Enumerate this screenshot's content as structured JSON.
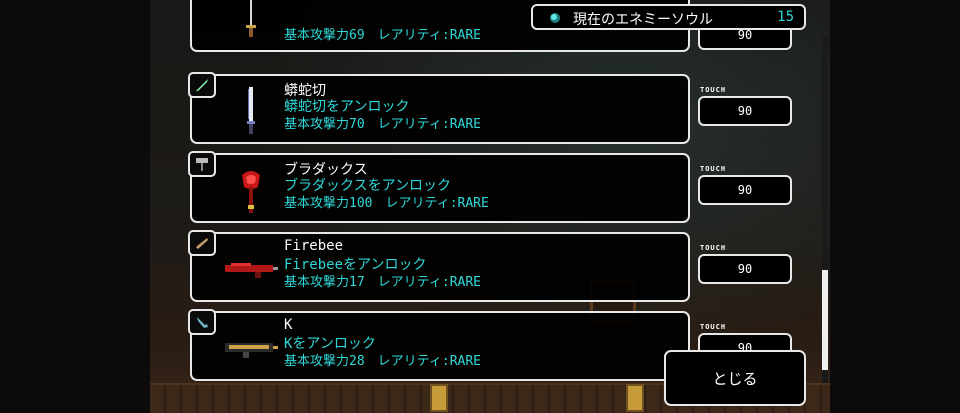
{
  "header": {
    "soul_label": "現在のエネミーソウル",
    "soul_value": "15",
    "soul_icon": "soul-orb-icon"
  },
  "touch_label": "TOUCH",
  "items": [
    {
      "name": "",
      "unlock": "",
      "stats": "基本攻撃力69　レアリティ:RARE",
      "cost": "90",
      "icon": "sword-icon",
      "color": "#c9a24a"
    },
    {
      "name": "蟒蛇切",
      "unlock": "蟒蛇切をアンロック",
      "stats": "基本攻撃力70　レアリティ:RARE",
      "cost": "90",
      "icon": "sword-icon",
      "color": "#d8d8e8"
    },
    {
      "name": "ブラダックス",
      "unlock": "ブラダックスをアンロック",
      "stats": "基本攻撃力100　レアリティ:RARE",
      "cost": "90",
      "icon": "hammer-icon",
      "color": "#d02020"
    },
    {
      "name": "Firebee",
      "unlock": "Firebeeをアンロック",
      "stats": "基本攻撃力17　レアリティ:RARE",
      "cost": "90",
      "icon": "gun-icon",
      "color": "#c01818"
    },
    {
      "name": "K",
      "unlock": "Kをアンロック",
      "stats": "基本攻撃力28　レアリティ:RARE",
      "cost": "90",
      "icon": "gun-icon",
      "color": "#c9a24a"
    }
  ],
  "close_label": "とじる",
  "colors": {
    "accent": "#2fd8d8",
    "border": "#e8e8e8"
  }
}
